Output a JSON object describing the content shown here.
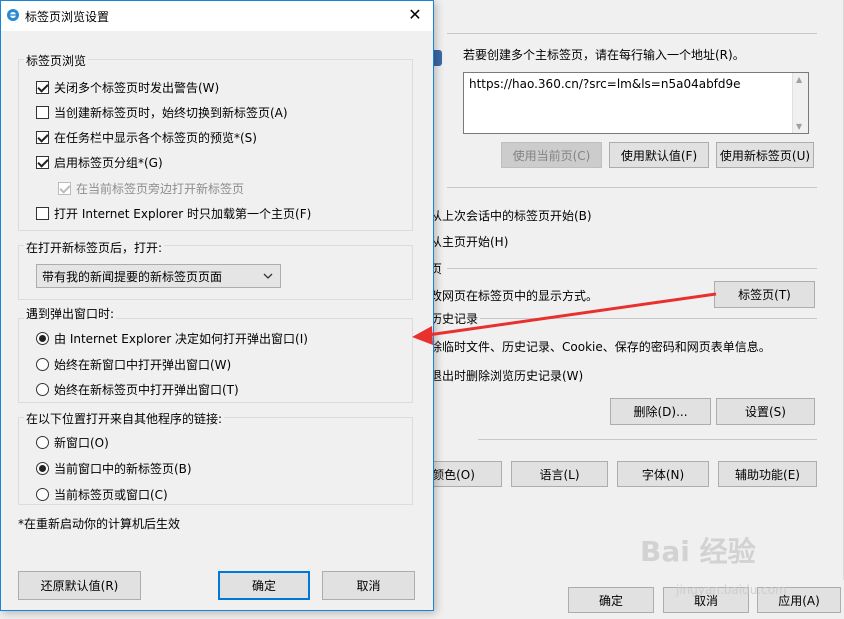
{
  "background": {
    "home_prompt": "若要创建多个主标签页，请在每行输入一个地址(R)。",
    "home_url": "https://hao.360.cn/?src=lm&ls=n5a04abfd9e",
    "btn_use_current": "使用当前页(C)",
    "btn_use_default": "使用默认值(F)",
    "btn_use_newtab": "使用新标签页(U)",
    "start_last_session": "从上次会话中的标签页开始(B)",
    "start_home": "从主页开始(H)",
    "tabs_frag": "页",
    "tabs_desc": "改网页在标签页中的显示方式。",
    "btn_tabs": "标签页(T)",
    "history_frag": "历史记录",
    "history_desc": "除临时文件、历史记录、Cookie、保存的密码和网页表单信息。",
    "delete_on_exit": "退出时删除浏览历史记录(W)",
    "btn_delete": "删除(D)...",
    "btn_settings": "设置(S)",
    "btn_colors": "颜色(O)",
    "btn_languages": "语言(L)",
    "btn_fonts": "字体(N)",
    "btn_accessibility": "辅助功能(E)",
    "btn_ok": "确定",
    "btn_cancel": "取消",
    "btn_apply": "应用(A)",
    "watermark": "Bai 经验",
    "watermark_sub": "jingyan.baidu.com"
  },
  "dialog": {
    "title": "标签页浏览设置",
    "group_tabs": {
      "title": "标签页浏览",
      "items": [
        {
          "label": "关闭多个标签页时发出警告(W)",
          "checked": true
        },
        {
          "label": "当创建新标签页时，始终切换到新标签页(A)",
          "checked": false
        },
        {
          "label": "在任务栏中显示各个标签页的预览*(S)",
          "checked": true
        },
        {
          "label": "启用标签页分组*(G)",
          "checked": true
        },
        {
          "label": "在当前标签页旁边打开新标签页",
          "checked": true,
          "disabled": true
        },
        {
          "label": "打开 Internet Explorer 时只加载第一个主页(F)",
          "checked": false
        }
      ]
    },
    "group_newtab": {
      "title": "在打开新标签页后，打开:",
      "selected": "带有我的新闻提要的新标签页页面"
    },
    "group_popup": {
      "title": "遇到弹出窗口时:",
      "options": [
        {
          "label": "由 Internet Explorer 决定如何打开弹出窗口(I)",
          "checked": true
        },
        {
          "label": "始终在新窗口中打开弹出窗口(W)",
          "checked": false
        },
        {
          "label": "始终在新标签页中打开弹出窗口(T)",
          "checked": false
        }
      ]
    },
    "group_links": {
      "title": "在以下位置打开来自其他程序的链接:",
      "options": [
        {
          "label": "新窗口(O)",
          "checked": false
        },
        {
          "label": "当前窗口中的新标签页(B)",
          "checked": true
        },
        {
          "label": "当前标签页或窗口(C)",
          "checked": false
        }
      ]
    },
    "footnote": "*在重新启动你的计算机后生效",
    "btn_restore": "还原默认值(R)",
    "btn_ok": "确定",
    "btn_cancel": "取消"
  },
  "colors": {
    "accent": "#0078d7",
    "arrow": "#e8312f"
  }
}
